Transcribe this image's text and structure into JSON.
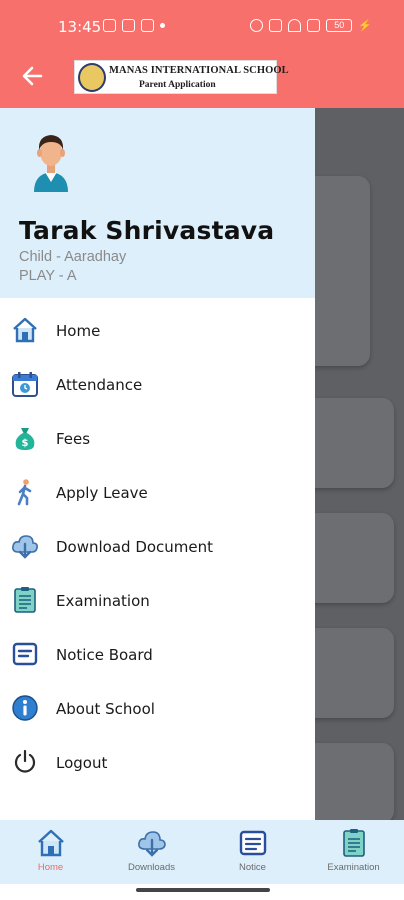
{
  "status_bar": {
    "time": "13:45",
    "battery": "50"
  },
  "header": {
    "school_name": "MANAS INTERNATIONAL SCHOOL",
    "app_subtitle": "Parent Application",
    "accent_color": "#f8706b"
  },
  "drawer": {
    "user_name": "Tarak Shrivastava",
    "child_line": "Child - Aaradhay",
    "class_line": "PLAY - A",
    "items": [
      {
        "label": "Home",
        "icon": "home-icon"
      },
      {
        "label": "Attendance",
        "icon": "calendar-icon"
      },
      {
        "label": "Fees",
        "icon": "money-bag-icon"
      },
      {
        "label": "Apply Leave",
        "icon": "walking-person-icon"
      },
      {
        "label": "Download Document",
        "icon": "cloud-download-icon"
      },
      {
        "label": "Examination",
        "icon": "exam-sheet-icon"
      },
      {
        "label": "Notice Board",
        "icon": "notice-board-icon"
      },
      {
        "label": "About School",
        "icon": "info-icon"
      },
      {
        "label": "Logout",
        "icon": "power-icon"
      }
    ]
  },
  "bottom_nav": {
    "items": [
      {
        "label": "Home",
        "active": true
      },
      {
        "label": "Downloads",
        "active": false
      },
      {
        "label": "Notice",
        "active": false
      },
      {
        "label": "Examination",
        "active": false
      }
    ],
    "active_color": "#f06a65"
  }
}
